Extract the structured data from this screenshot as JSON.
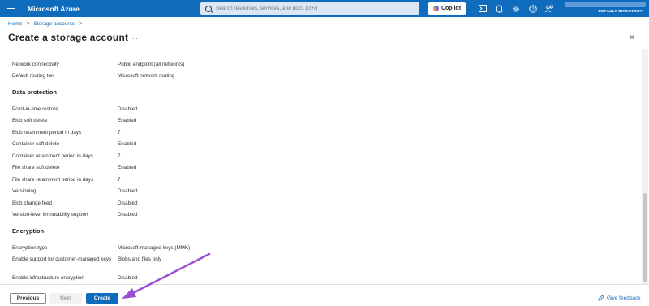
{
  "topbar": {
    "brand": "Microsoft Azure",
    "search_placeholder": "Search resources, services, and docs (G+/)",
    "copilot_label": "Copilot",
    "directory": "DEFAULT DIRECTORY",
    "accent": "#0f6cbd"
  },
  "breadcrumb": {
    "home": "Home",
    "storage": "Storage accounts",
    "sep": ">"
  },
  "page": {
    "title": "Create a storage account",
    "more": "...",
    "close": "×"
  },
  "networking": [
    {
      "label": "Network connectivity",
      "value": "Public endpoint (all networks)"
    },
    {
      "label": "Default routing tier",
      "value": "Microsoft network routing"
    }
  ],
  "data_protection": {
    "heading": "Data protection",
    "rows": [
      {
        "label": "Point-in-time restore",
        "value": "Disabled"
      },
      {
        "label": "Blob soft delete",
        "value": "Enabled"
      },
      {
        "label": "Blob retainment period in days",
        "value": "7"
      },
      {
        "label": "Container soft delete",
        "value": "Enabled"
      },
      {
        "label": "Container retainment period in days",
        "value": "7"
      },
      {
        "label": "File share soft delete",
        "value": "Enabled"
      },
      {
        "label": "File share retainment period in days",
        "value": "7"
      },
      {
        "label": "Versioning",
        "value": "Disabled"
      },
      {
        "label": "Blob change feed",
        "value": "Disabled"
      },
      {
        "label": "Version-level immutability support",
        "value": "Disabled"
      }
    ]
  },
  "encryption": {
    "heading": "Encryption",
    "rows": [
      {
        "label": "Encryption type",
        "value": "Microsoft-managed keys (MMK)"
      },
      {
        "label": "Enable support for customer-managed keys",
        "value": "Blobs and files only"
      },
      {
        "label": "Enable infrastructure encryption",
        "value": "Disabled"
      }
    ]
  },
  "footer": {
    "previous": "Previous",
    "next": "Next",
    "create": "Create",
    "feedback": "Give feedback"
  }
}
